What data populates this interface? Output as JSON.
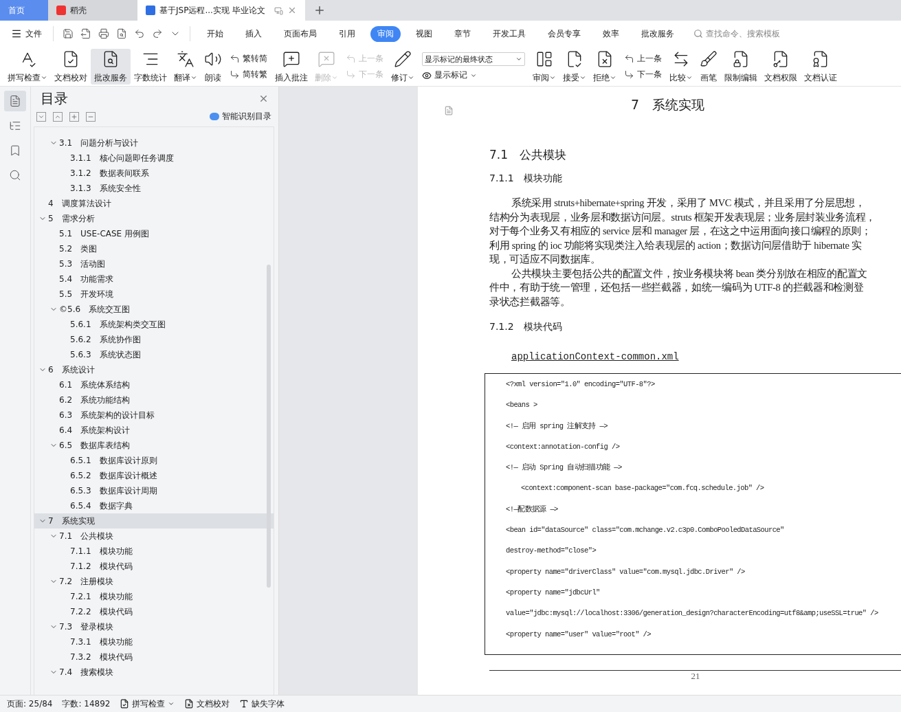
{
  "window_tabs": [
    {
      "kind": "home",
      "label": "首页",
      "selected": false
    },
    {
      "kind": "app",
      "label": "稻壳",
      "selected": false
    },
    {
      "kind": "doc",
      "label": "基于JSP远程...实现 毕业论文",
      "selected": true
    }
  ],
  "menu": {
    "file": "文件",
    "tabs": [
      {
        "label": "开始",
        "selected": false
      },
      {
        "label": "插入",
        "selected": false
      },
      {
        "label": "页面布局",
        "selected": false
      },
      {
        "label": "引用",
        "selected": false
      },
      {
        "label": "审阅",
        "selected": true
      },
      {
        "label": "视图",
        "selected": false
      },
      {
        "label": "章节",
        "selected": false
      },
      {
        "label": "开发工具",
        "selected": false
      },
      {
        "label": "会员专享",
        "selected": false
      },
      {
        "label": "效率",
        "selected": false
      },
      {
        "label": "批改服务",
        "selected": false
      }
    ],
    "search": {
      "placeholder": "查找命令、搜索模板"
    }
  },
  "ribbon": [
    {
      "kind": "large",
      "label": "拼写检查",
      "caret": true,
      "disabled": false,
      "active": false
    },
    {
      "kind": "large",
      "label": "文档校对",
      "caret": false,
      "disabled": false,
      "active": false
    },
    {
      "kind": "large",
      "label": "批改服务",
      "caret": false,
      "disabled": false,
      "active": true
    },
    {
      "kind": "large",
      "label": "字数统计",
      "caret": false,
      "disabled": false,
      "active": false
    },
    {
      "kind": "large",
      "label": "翻译",
      "caret": true,
      "disabled": false,
      "active": false
    },
    {
      "kind": "large",
      "label": "朗读",
      "caret": false,
      "disabled": false,
      "active": false
    },
    {
      "kind": "pair",
      "items": [
        {
          "label": "繁转简",
          "disabled": false
        },
        {
          "label": "简转繁",
          "disabled": false
        }
      ]
    },
    {
      "kind": "large",
      "label": "插入批注",
      "caret": false,
      "disabled": false,
      "active": false
    },
    {
      "kind": "large",
      "label": "删除",
      "caret": true,
      "disabled": true,
      "active": false
    },
    {
      "kind": "pair",
      "items": [
        {
          "label": "上一条",
          "disabled": true
        },
        {
          "label": "下一条",
          "disabled": true
        }
      ]
    },
    {
      "kind": "large",
      "label": "修订",
      "caret": true,
      "disabled": false,
      "active": false
    },
    {
      "kind": "select",
      "value": "显示标记的最终状态",
      "label": "显示标记"
    },
    {
      "kind": "large",
      "label": "审阅",
      "caret": true,
      "disabled": false,
      "active": false
    },
    {
      "kind": "large",
      "label": "接受",
      "caret": true,
      "disabled": false,
      "active": false
    },
    {
      "kind": "large",
      "label": "拒绝",
      "caret": true,
      "disabled": false,
      "active": false
    },
    {
      "kind": "pair",
      "items": [
        {
          "label": "上一条",
          "disabled": false
        },
        {
          "label": "下一条",
          "disabled": false
        }
      ]
    },
    {
      "kind": "large",
      "label": "比较",
      "caret": true,
      "disabled": false,
      "active": false
    },
    {
      "kind": "large",
      "label": "画笔",
      "caret": false,
      "disabled": false,
      "active": false
    },
    {
      "kind": "large",
      "label": "限制编辑",
      "caret": false,
      "disabled": false,
      "active": false
    },
    {
      "kind": "large",
      "label": "文档权限",
      "caret": false,
      "disabled": false,
      "active": false
    },
    {
      "kind": "large",
      "label": "文档认证",
      "caret": false,
      "disabled": false,
      "active": false
    }
  ],
  "side_strip": [
    {
      "selected": true
    },
    {
      "selected": false
    },
    {
      "selected": false
    },
    {
      "selected": false
    }
  ],
  "toc": {
    "title": "目录",
    "smart": "智能识别目录",
    "partial_children": [
      {
        "label": "3.1　问题分析与设计",
        "selected": false,
        "expanded": true,
        "children": [
          {
            "label": "3.1.1　核心问题即任务调度",
            "selected": false
          },
          {
            "label": "3.1.2　数据表间联系",
            "selected": false
          },
          {
            "label": "3.1.3　系统安全性",
            "selected": false
          }
        ]
      }
    ],
    "items": [
      {
        "label": "4　调度算法设计",
        "selected": false
      },
      {
        "label": "5　需求分析",
        "selected": false,
        "expanded": true,
        "children": [
          {
            "label": "5.1　USE-CASE 用例图",
            "selected": false
          },
          {
            "label": "5.2　类图",
            "selected": false
          },
          {
            "label": "5.3　活动图",
            "selected": false
          },
          {
            "label": "5.4　功能需求",
            "selected": false
          },
          {
            "label": "5.5　开发环境",
            "selected": false
          },
          {
            "label": "©5.6　系统交互图",
            "selected": false,
            "expanded": true,
            "children": [
              {
                "label": "5.6.1　系统架构类交互图",
                "selected": false
              },
              {
                "label": "5.6.2　系统协作图",
                "selected": false
              },
              {
                "label": "5.6.3　系统状态图",
                "selected": false
              }
            ]
          }
        ]
      },
      {
        "label": "6　系统设计",
        "selected": false,
        "expanded": true,
        "children": [
          {
            "label": "6.1　系统体系结构",
            "selected": false
          },
          {
            "label": "6.2　系统功能结构",
            "selected": false
          },
          {
            "label": "6.3　系统架构的设计目标",
            "selected": false
          },
          {
            "label": "6.4　系统架构设计",
            "selected": false
          },
          {
            "label": "6.5　数据库表结构",
            "selected": false,
            "expanded": true,
            "children": [
              {
                "label": "6.5.1　数据库设计原则",
                "selected": false
              },
              {
                "label": "6.5.2　数据库设计概述",
                "selected": false
              },
              {
                "label": "6.5.3　数据库设计周期",
                "selected": false
              },
              {
                "label": "6.5.4　数据字典",
                "selected": false
              }
            ]
          }
        ]
      },
      {
        "label": "7　系统实现",
        "selected": true,
        "expanded": true,
        "children": [
          {
            "label": "7.1　公共模块",
            "selected": false,
            "expanded": true,
            "children": [
              {
                "label": "7.1.1　模块功能",
                "selected": false
              },
              {
                "label": "7.1.2　模块代码",
                "selected": false
              }
            ]
          },
          {
            "label": "7.2　注册模块",
            "selected": false,
            "expanded": true,
            "children": [
              {
                "label": "7.2.1　模块功能",
                "selected": false
              },
              {
                "label": "7.2.2　模块代码",
                "selected": false
              }
            ]
          },
          {
            "label": "7.3　登录模块",
            "selected": false,
            "expanded": true,
            "children": [
              {
                "label": "7.3.1　模块功能",
                "selected": false
              },
              {
                "label": "7.3.2　模块代码",
                "selected": false
              }
            ]
          },
          {
            "label": "7.4　搜索模块",
            "selected": false,
            "expanded": true
          }
        ]
      }
    ]
  },
  "document": {
    "chapter": "7　系统实现",
    "h2": "7.1　公共模块",
    "h3a": "7.1.1　模块功能",
    "paragraphs": [
      [
        "系统采用 struts+hibernate+spring 开发，采用了 MVC 模式，并且采用了分层思想，",
        "结构分为表现层，业务层和数据访问层。struts 框架开发表现层；业务层封装业务流程，",
        "对于每个业务又有相应的 service 层和 manager 层，在这之中运用面向接口编程的原则；",
        "利用 spring 的 ioc 功能将实现类注入给表现层的 action；数据访问层借助于 hibernate 实",
        "现，可适应不同数据库。"
      ],
      [
        "公共模块主要包括公共的配置文件，按业务模块将 bean 类分别放在相应的配置文",
        "件中，有助于统一管理，还包括一些拦截器，如统一编码为 UTF-8 的拦截器和检测登",
        "录状态拦截器等。"
      ]
    ],
    "h3b": "7.1.2　模块代码",
    "file_name": "applicationContext-common.xml",
    "code": [
      {
        "text": "<?xml version=\"1.0\" encoding=\"UTF-8\"?>",
        "indented": false
      },
      {
        "text": "<beans >",
        "indented": false
      },
      {
        "text": "<!— 启用 spring 注解支持 —>",
        "indented": false
      },
      {
        "text": "<context:annotation-config />",
        "indented": false
      },
      {
        "text": "<!— 启动 Spring 自动扫描功能 —>",
        "indented": false
      },
      {
        "text": "<context:component-scan base-package=\"com.fcq.schedule.job\" />",
        "indented": true
      },
      {
        "text": "<!—配数据源 —>",
        "indented": false
      },
      {
        "text": "<bean id=\"dataSource\" class=\"com.mchange.v2.c3p0.ComboPooledDataSource\"",
        "indented": false
      },
      {
        "text": "destroy-method=\"close\">",
        "indented": false
      },
      {
        "text": "<property name=\"driverClass\" value=\"com.mysql.jdbc.Driver\" />",
        "indented": false
      },
      {
        "text": "<property name=\"jdbcUrl\"",
        "indented": false
      },
      {
        "text": "value=\"jdbc:mysql://localhost:3306/generation_design?characterEncoding=utf8&amp;useSSL=true\" />",
        "indented": false
      },
      {
        "text": "<property name=\"user\" value=\"root\" />",
        "indented": false
      }
    ],
    "page_number": "21"
  },
  "status_bar": {
    "page": "页面: 25/84",
    "words": "字数: 14892",
    "spell": "拼写检查",
    "proof": "文档校对",
    "fonts": "缺失字体"
  }
}
